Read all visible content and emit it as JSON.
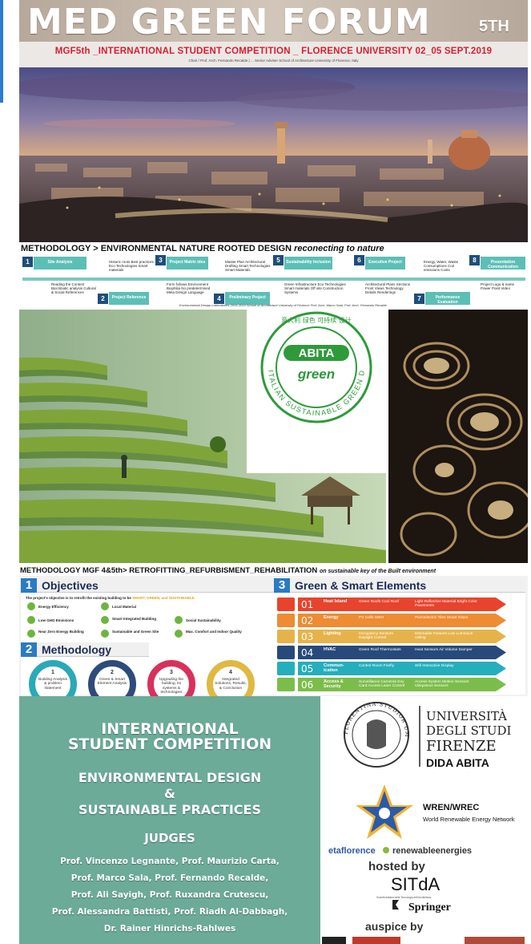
{
  "header": {
    "title": "MED GREEN FORUM",
    "edition": "5TH",
    "competition": "MGF5th _INTERNATIONAL STUDENT COMPETITION _ FLORENCE UNIVERSITY 02_05 SEPT.2019",
    "chair_line": "Chair / Prof. Arch. Fernando Recalde | ... Senior Adviser School of Architecture University of Florence, Italy"
  },
  "methodology": {
    "heading": "METHODOLOGY > ENVIRONMENTAL NATURE ROOTED DESIGN",
    "heading_italic": "reconecting to nature",
    "steps": [
      {
        "num": "1",
        "label": "Site Analysis"
      },
      {
        "num": "2",
        "label": "Project Reference"
      },
      {
        "num": "3",
        "label": "Project Matrix idea"
      },
      {
        "num": "4",
        "label": "Preliminary Project"
      },
      {
        "num": "5",
        "label": "Sustainability Inclusion"
      },
      {
        "num": "6",
        "label": "Executive Project"
      },
      {
        "num": "7",
        "label": "Performance Evaluation"
      },
      {
        "num": "8",
        "label": "Presentation Communication"
      }
    ],
    "notes": [
      "Reading the Context Bioclimatic analysis Cultural & Social References",
      "Historic roots Best practices Eco Technologies Smart materials",
      "Form follows Environment Biophilia No predetermined Meta Design Language",
      "Master Plan Architectural Drafting Smart Technologies Smart Materials",
      "Green Infrastructure Eco Technologies Smart materials Off site Construction Systems",
      "Architectural Plans Sections Front Views Technology Details Renderings",
      "Energy, Water, Waste Consumptions Co2 emissions Costs",
      "Project Logo & name Power Point Video"
    ],
    "footer": "Environmental Design Laboratories 2015-2019 School of Architecture University of Florence Prof. Arch. Marco Sala, Prof. Arch. Fernando Recalde"
  },
  "abita": {
    "logo_top": "ABITA",
    "logo_bottom": "green",
    "ring_text": "ITALIAN SUSTAINABLE GREEN DESIGN",
    "chinese": "意大利 绿色 可持续 设计"
  },
  "retro": {
    "heading": "METHODOLOGY MGF 4&5th> RETROFITTING_REFURBISMENT_REHABILITATION",
    "heading_italic": "on sustainable key of the Built environment"
  },
  "objectives": {
    "num": "1",
    "title": "Objectives",
    "intro": "The project's objective is to retrofit the existing building to be",
    "intro_tail": "SMART, GREEN, and SUSTAINABLE.",
    "items": [
      "Energy Efficiency",
      "Local Material",
      "Low GHG Emissions",
      "Smart Integrated Building",
      "Social Sustainability",
      "Near Zero Energy Building",
      "Sustainable and Green Site",
      "Max. Comfort and Indoor Quality"
    ]
  },
  "method2": {
    "num": "2",
    "title": "Methodology",
    "circles": [
      {
        "n": "1",
        "t": "Building Analysis & problem statement"
      },
      {
        "n": "2",
        "t": "Green & Smart Element Analysis"
      },
      {
        "n": "3",
        "t": "Upgrading the building, its systems & technologies"
      },
      {
        "n": "4",
        "t": "Integrated Solutions, Results, & Conclusion"
      }
    ]
  },
  "green": {
    "num": "3",
    "title": "Green & Smart Elements",
    "colors": [
      "#e8432c",
      "#ee8b33",
      "#e6b34a",
      "#274a7a",
      "#25aebb",
      "#7bbd4a"
    ],
    "rows": [
      {
        "n": "01",
        "l": "Heat Island",
        "a": "Green Roofs Cool Roof",
        "b": "Light Reflective Material Bright Color Pavements"
      },
      {
        "n": "02",
        "l": "Energy",
        "a": "PV Cells SWH",
        "b": "Piezoelectric Tiles Smart Glass"
      },
      {
        "n": "03",
        "l": "Lighting",
        "a": "Occupancy Sensors Daylight Control",
        "b": "Dimmable Fixtures Low Luminous ceiling"
      },
      {
        "n": "04",
        "l": "HVAC",
        "a": "Green Roof Thermostats",
        "b": "Heat Sensors Air Volume Damper"
      },
      {
        "n": "05",
        "l": "Commun-ication",
        "a": "Control Room Firefly",
        "b": "Wifi Interactive Display"
      },
      {
        "n": "06",
        "l": "Access & Security",
        "a": "Surveillance Cameras Key Card Access Laser Control",
        "b": "Access System Motion Sensors Ubiquitous Sensors"
      }
    ]
  },
  "competition": {
    "line1": "INTERNATIONAL",
    "line2": "STUDENT COMPETITION",
    "env1": "ENVIRONMENTAL DESIGN",
    "env2": "&",
    "env3": "SUSTAINABLE PRACTICES",
    "judges_title": "JUDGES",
    "judges": [
      "Prof. Vincenzo Legnante, Prof. Maurizio Carta,",
      "Prof. Marco Sala, Prof. Fernando Recalde,",
      "Prof. Ali Sayigh, Prof. Ruxandra Crutescu,",
      "Prof. Alessandra Battisti, Prof. Riadh Al-Dabbagh,",
      "Dr. Rainer Hinrichs-Rahlwes"
    ]
  },
  "sponsors": {
    "unifi1": "UNIVERSITÀ",
    "unifi2": "DEGLI STUDI",
    "unifi3": "FIRENZE",
    "unifi4": "DIDA ABITA",
    "seal_text": "FLORENTINA STUDIOR UM UNIVERSITAS",
    "wren": "WREN/WREC",
    "wren_sub": "World Renewable Energy Network",
    "eta_a": "etaflorence",
    "eta_b": "renewableenergies",
    "hosted": "hosted by",
    "sitda": "SITdA",
    "sitda_sub": "Società Italiana della Tecnologia dell'Architettura",
    "springer": "Springer",
    "auspice": "auspice by"
  }
}
